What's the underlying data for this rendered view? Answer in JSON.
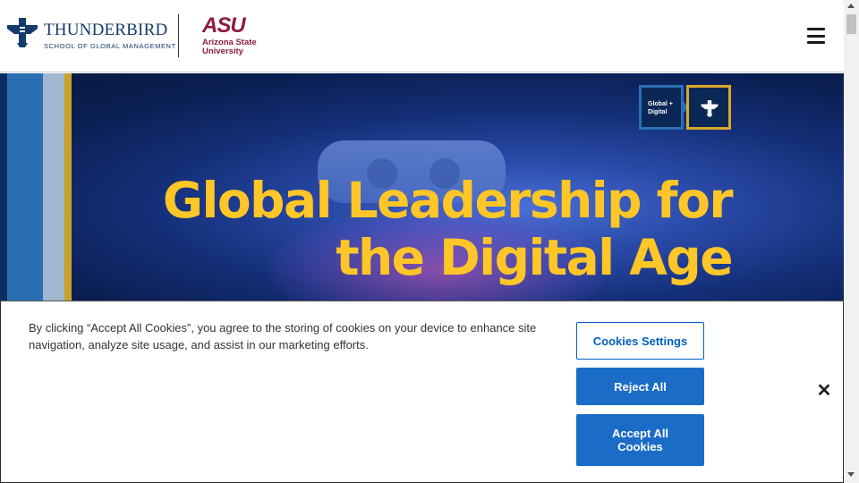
{
  "header": {
    "tb_logo_icon": "thunderbird-emblem",
    "tb_name": "THUNDERBIRD",
    "tb_sub": "SCHOOL OF GLOBAL MANAGEMENT",
    "asu_mark": "ASU",
    "asu_name_line1": "Arizona State",
    "asu_name_line2": "University",
    "menu_icon": "hamburger-menu-icon"
  },
  "hero": {
    "badge_text_line1": "Global +",
    "badge_text_line2": "Digital",
    "title_line1": "Global Leadership for",
    "title_line2": "the Digital Age",
    "title_color": "#ffc627"
  },
  "cookie_banner": {
    "text": "By clicking “Accept All Cookies”, you agree to the storing of cookies on your device to enhance site navigation, analyze site usage, and assist in our marketing efforts.",
    "settings_label": "Cookies Settings",
    "reject_label": "Reject All",
    "accept_label": "Accept All Cookies",
    "close_icon": "close-icon",
    "accent_color": "#1a6cc7"
  }
}
